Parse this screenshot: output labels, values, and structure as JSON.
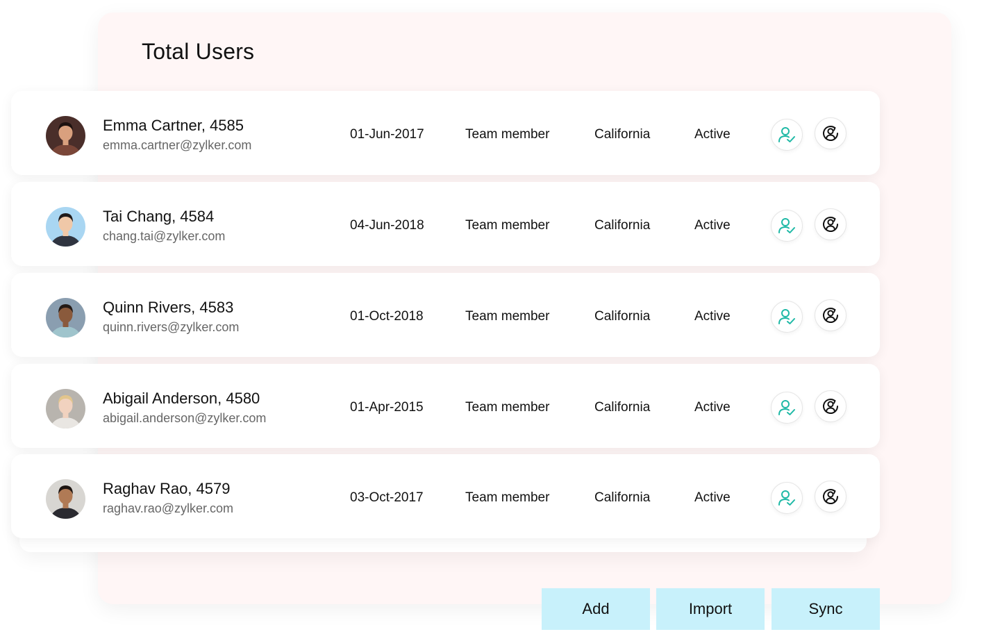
{
  "title": "Total Users",
  "users": [
    {
      "name": "Emma Cartner, 4585",
      "email": "emma.cartner@zylker.com",
      "date": "01-Jun-2017",
      "role": "Team member",
      "location": "California",
      "status": "Active",
      "avatar_bg": "#4a2e2a",
      "avatar_skin": "#d9a07e",
      "avatar_hair": "#1e1210",
      "avatar_shirt": "#7a4638"
    },
    {
      "name": "Tai Chang, 4584",
      "email": "chang.tai@zylker.com",
      "date": "04-Jun-2018",
      "role": "Team member",
      "location": "California",
      "status": "Active",
      "avatar_bg": "#a9d6f2",
      "avatar_skin": "#f0c8a8",
      "avatar_hair": "#1f1a1a",
      "avatar_shirt": "#2f3440"
    },
    {
      "name": "Quinn Rivers, 4583",
      "email": "quinn.rivers@zylker.com",
      "date": "01-Oct-2018",
      "role": "Team member",
      "location": "California",
      "status": "Active",
      "avatar_bg": "#8a9eb0",
      "avatar_skin": "#8a5a3c",
      "avatar_hair": "#231a16",
      "avatar_shirt": "#9fc4cc"
    },
    {
      "name": "Abigail Anderson, 4580",
      "email": "abigail.anderson@zylker.com",
      "date": "01-Apr-2015",
      "role": "Team member",
      "location": "California",
      "status": "Active",
      "avatar_bg": "#b8b4ae",
      "avatar_skin": "#f1d2bf",
      "avatar_hair": "#e2c58c",
      "avatar_shirt": "#e9e6e2"
    },
    {
      "name": "Raghav Rao, 4579",
      "email": "raghav.rao@zylker.com",
      "date": "03-Oct-2017",
      "role": "Team member",
      "location": "California",
      "status": "Active",
      "avatar_bg": "#d8d6d2",
      "avatar_skin": "#b07a55",
      "avatar_hair": "#1c1410",
      "avatar_shirt": "#2a2a30"
    }
  ],
  "icons": {
    "approve": "user-check-icon",
    "sync": "user-sync-icon"
  },
  "actions": {
    "add": "Add",
    "import": "Import",
    "sync": "Sync"
  },
  "colors": {
    "panel_bg": "#fff6f6",
    "button_bg": "#c8f1fb",
    "approve_icon": "#1fb9a6",
    "sync_icon": "#111111"
  }
}
